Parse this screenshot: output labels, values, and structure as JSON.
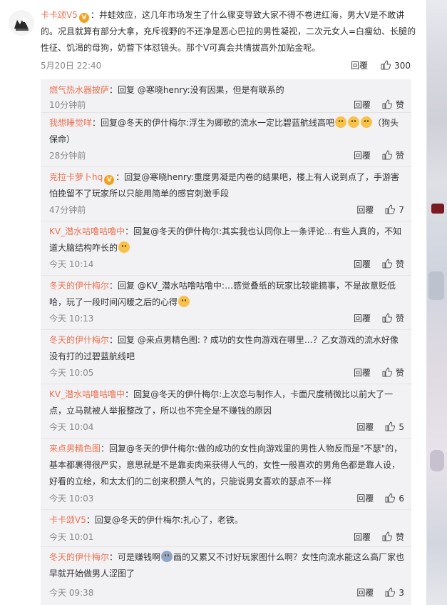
{
  "main": {
    "username": "卡卡颂V5",
    "text": "：井蛙效应，这几年市场发生了什么骤变导致大家不得不卷进红海，男大V是不敢讲的。况且就算有部分大拿，充斥视野的不还净是恶心巴拉的男性凝视，二次元女人=白瘦幼、长腿的性征、饥渴的母狗，奶瞀下体怼镜头。那个V可真会共情拔高外加贴金呢。",
    "time": "5月20日 22:40",
    "reply_label": "回覆",
    "likes": "300"
  },
  "replies": [
    {
      "name": "燃气热水器披萨",
      "text": "：回复 @寒晓henry:没有因果，但是有联系的",
      "time": "10分钟前",
      "likes": "",
      "reply_label": "回覆"
    },
    {
      "name": "我想睡觉咩",
      "text": "：回复@冬天的伊什梅尔:浮生为卿歌的流水一定比碧蓝航线高吧",
      "tail": "（狗头保命）",
      "time": "28分钟前",
      "likes": "",
      "reply_label": "回覆"
    },
    {
      "name": "克拉卡萝卜hq",
      "text": "：回复@寒晓henry:重度男凝是内卷的结果吧，楼上有人说到点了，手游害怕挽留不了玩家所以只能用简单的感官刺激手段",
      "time": "47分钟前",
      "likes": "7",
      "reply_label": "回覆"
    },
    {
      "name": "KV_潜水咕噜咕噜中",
      "text": "：回复@冬天的伊什梅尔:其实我也认同你上一条评论…有些人真的，不知道大脑结构咋长的",
      "time": "今天 10:14",
      "likes": "",
      "reply_label": "回覆"
    },
    {
      "name": "冬天的伊什梅尔",
      "text": "：回复 @KV_潜水咕噜咕噜中:…感觉叠纸的玩家比较能搞事，不是故意贬低哈，玩了一段时间闪暖之后的心得",
      "time": "今天 10:13",
      "likes": "",
      "reply_label": "回覆"
    },
    {
      "name": "冬天的伊什梅尔",
      "text": "：回复 @来点男精色图: ? 成功的女性向游戏在哪里…？乙女游戏的流水好像没有打的过碧蓝航线吧",
      "time": "今天 10:05",
      "likes": "",
      "reply_label": "回覆"
    },
    {
      "name": "KV_潜水咕噜咕噜中",
      "text": "：回复@冬天的伊什梅尔:上次恋与制作人，卡面尺度稍微比以前大了一点，立马就被人举报整改了，所以也不完全是不赚钱的原因",
      "time": "今天 10:04",
      "likes": "5",
      "reply_label": "回覆"
    },
    {
      "name": "来点男精色图",
      "text": "：回复@冬天的伊什梅尔:做的成功的女性向游戏里的男性人物反而是\"不瑟\"的，基本都裹得很严实，意思就是不是靠卖肉来获得人气的，女性一般喜欢的男角色都是靠人设，好看的立绘，和太太们的二创来积攒人气的，只能说男女喜欢的瑟点不一样",
      "time": "今天 10:03",
      "likes": "6",
      "reply_label": "回覆"
    },
    {
      "name": "卡卡颂V5",
      "text": "：回复@冬天的伊什梅尔:扎心了，老铁。",
      "time": "今天 10:01",
      "likes": "",
      "reply_label": "回覆"
    },
    {
      "name": "冬天的伊什梅尔",
      "text": "：可是赚钱啊",
      "tail": "画的又累又不讨好玩家图什么啊？女性向流水能这么高厂家也早就开始做男人涩图了",
      "time": "今天 09:38",
      "likes": "3",
      "reply_label": "回覆"
    }
  ]
}
